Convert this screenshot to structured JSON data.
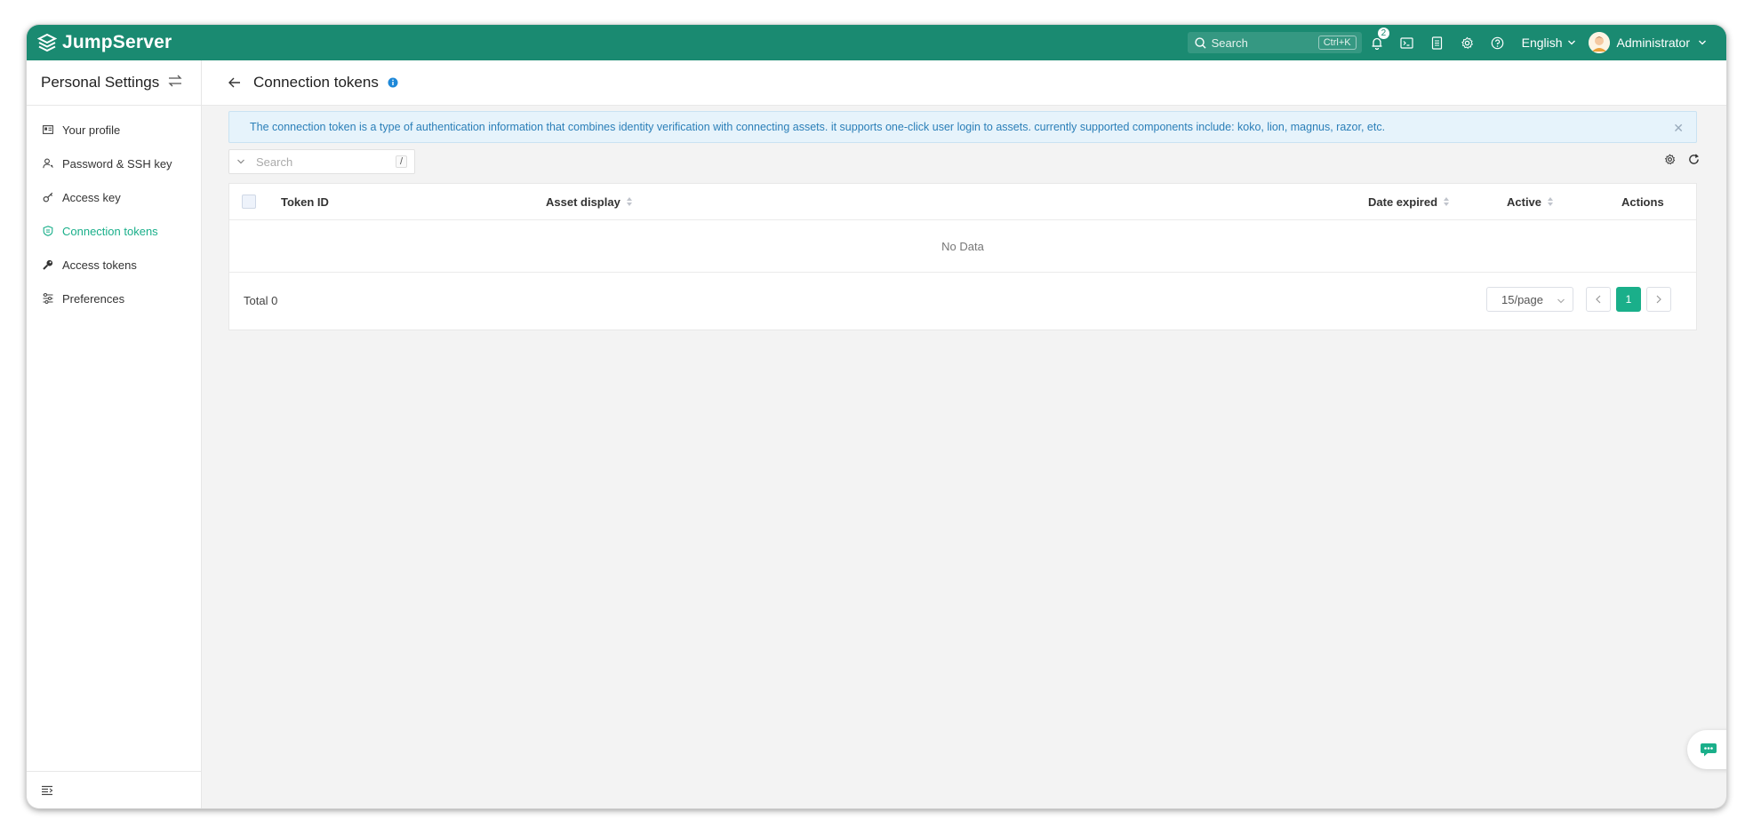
{
  "app": {
    "name": "JumpServer"
  },
  "header": {
    "search_placeholder": "Search",
    "search_shortcut": "Ctrl+K",
    "notification_count": "2",
    "language": "English",
    "user": "Administrator"
  },
  "sidebar": {
    "title": "Personal Settings",
    "items": [
      {
        "label": "Your profile",
        "icon": "id-card-icon"
      },
      {
        "label": "Password & SSH key",
        "icon": "user-key-icon"
      },
      {
        "label": "Access key",
        "icon": "key-icon"
      },
      {
        "label": "Connection tokens",
        "icon": "token-icon",
        "active": true
      },
      {
        "label": "Access tokens",
        "icon": "wrench-key-icon"
      },
      {
        "label": "Preferences",
        "icon": "sliders-icon"
      }
    ]
  },
  "page": {
    "title": "Connection tokens"
  },
  "alert": {
    "text": "The connection token is a type of authentication information that combines identity verification with connecting assets. it supports one-click user login to assets. currently supported components include: koko, lion, magnus, razor, etc."
  },
  "table": {
    "search_placeholder": "Search",
    "search_shortcut": "/",
    "columns": [
      "Token ID",
      "Asset display",
      "Date expired",
      "Active",
      "Actions"
    ],
    "rows": [],
    "empty_text": "No Data",
    "total": "Total 0",
    "page_size": "15/page",
    "current_page": "1"
  },
  "colors": {
    "brand": "#1a8a71",
    "accent": "#1aaf8a",
    "info": "#2b7fb8"
  }
}
